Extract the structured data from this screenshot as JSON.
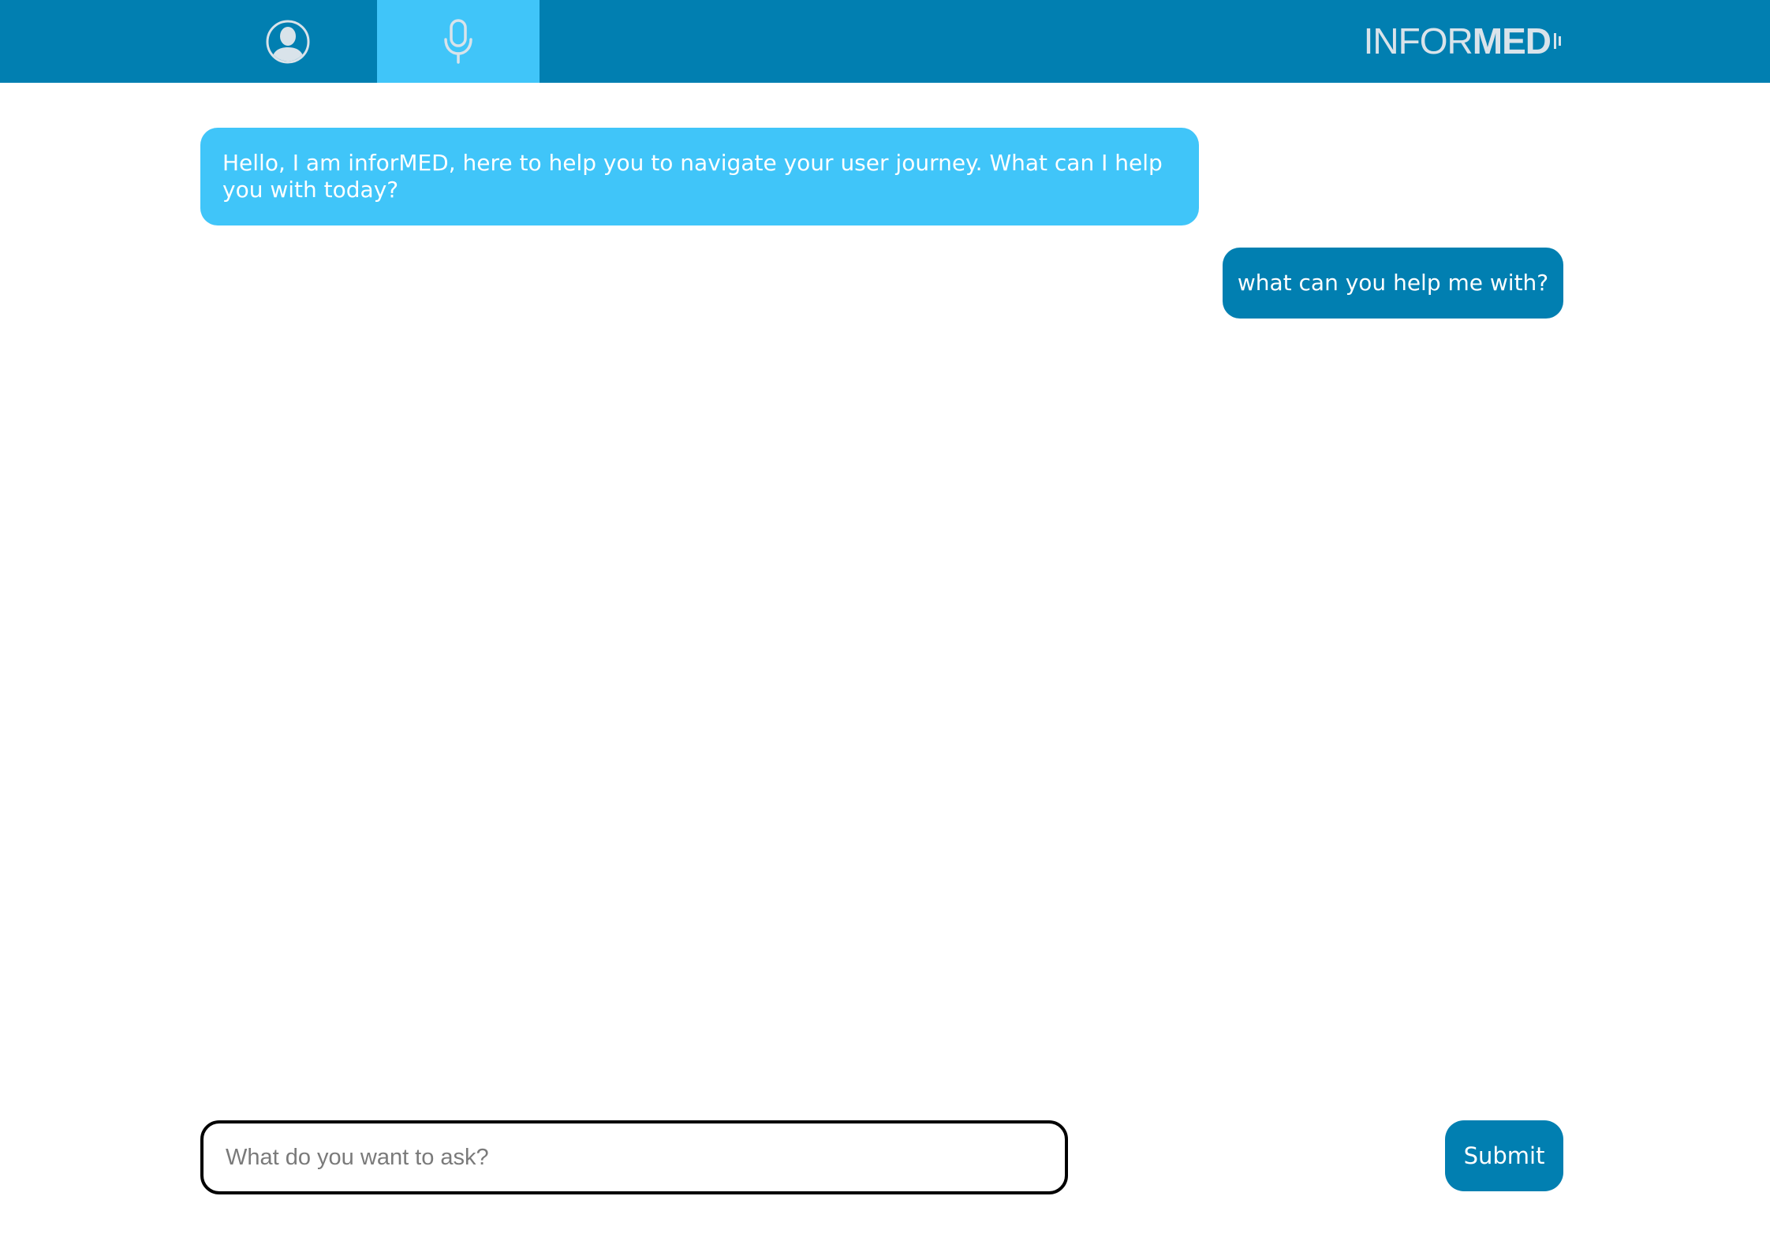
{
  "header": {
    "tabs": [
      {
        "name": "profile",
        "icon": "user-profile-icon",
        "active": false
      },
      {
        "name": "voice",
        "icon": "microphone-icon",
        "active": true
      }
    ],
    "logo": {
      "light": "INFOR",
      "bold": "MED"
    }
  },
  "chat": {
    "messages": [
      {
        "from": "bot",
        "text": "Hello, I am inforMED, here to help you to navigate your user journey. What can I help you with today?"
      },
      {
        "from": "user",
        "text": "what can you help me with?"
      }
    ]
  },
  "composer": {
    "placeholder": "What do you want to ask?",
    "value": "",
    "submit_label": "Submit"
  },
  "colors": {
    "header": "#017fb1",
    "active_tab": "#40c5f9",
    "bot_bubble": "#40c5f9",
    "user_bubble": "#017fb1",
    "logo_text": "#d9e3ea"
  }
}
